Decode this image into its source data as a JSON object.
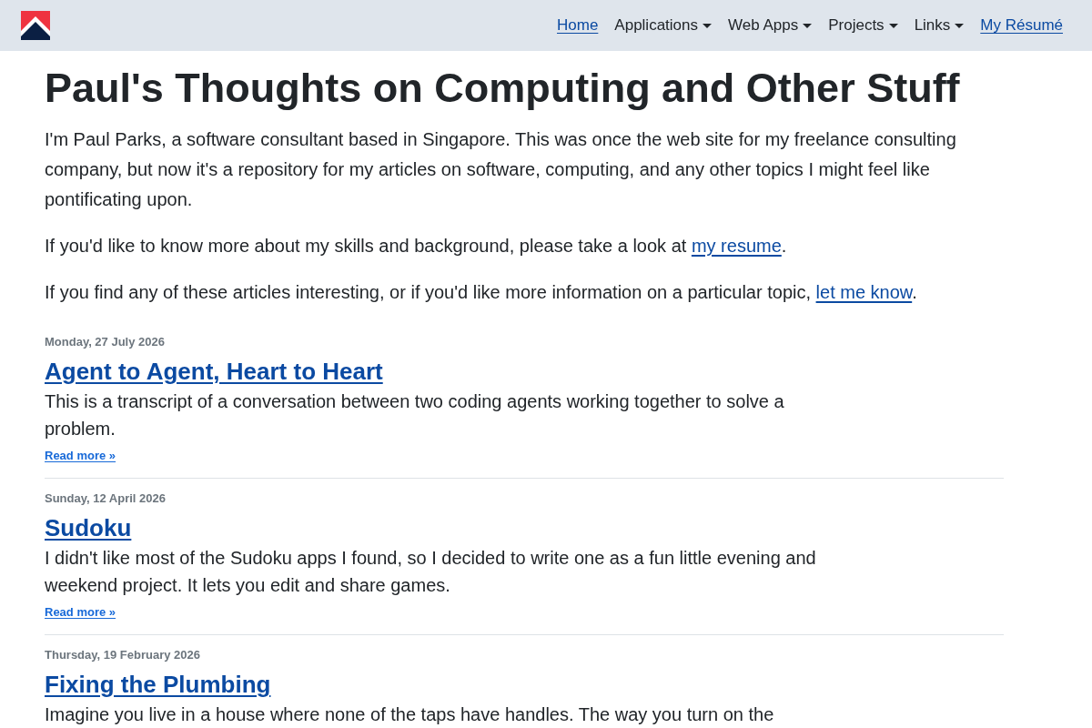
{
  "nav": {
    "items": [
      {
        "label": "Home",
        "kind": "link"
      },
      {
        "label": "Applications",
        "kind": "dropdown"
      },
      {
        "label": "Web Apps",
        "kind": "dropdown"
      },
      {
        "label": "Projects",
        "kind": "dropdown"
      },
      {
        "label": "Links",
        "kind": "dropdown"
      },
      {
        "label": "My Résumé",
        "kind": "link"
      }
    ]
  },
  "page": {
    "title": "Paul's Thoughts on Computing and Other Stuff",
    "intro": [
      {
        "text": "I'm Paul Parks, a software consultant based in Singapore. This was once the web site for my freelance consulting company, but now it's a repository for my articles on software, computing, and any other topics I might feel like pontificating upon."
      },
      {
        "text": "If you'd like to know more about my skills and background, please take a look at ",
        "link": "my resume",
        "tail": "."
      },
      {
        "text": "If you find any of these articles interesting, or if you'd like more information on a particular topic, ",
        "link": "let me know",
        "tail": "."
      }
    ]
  },
  "articles": [
    {
      "date": "Monday, 27 July 2026",
      "title": "Agent to Agent, Heart to Heart",
      "summary": "This is a transcript of a conversation between two coding agents working together to solve a problem.",
      "read_more": "Read more »"
    },
    {
      "date": "Sunday, 12 April 2026",
      "title": "Sudoku",
      "summary": "I didn't like most of the Sudoku apps I found, so I decided to write one as a fun little evening and weekend project. It lets you edit and share games.",
      "read_more": "Read more »"
    },
    {
      "date": "Thursday, 19 February 2026",
      "title": "Fixing the Plumbing",
      "summary": "Imagine you live in a house where none of the taps have handles. The way you turn on the"
    }
  ]
}
